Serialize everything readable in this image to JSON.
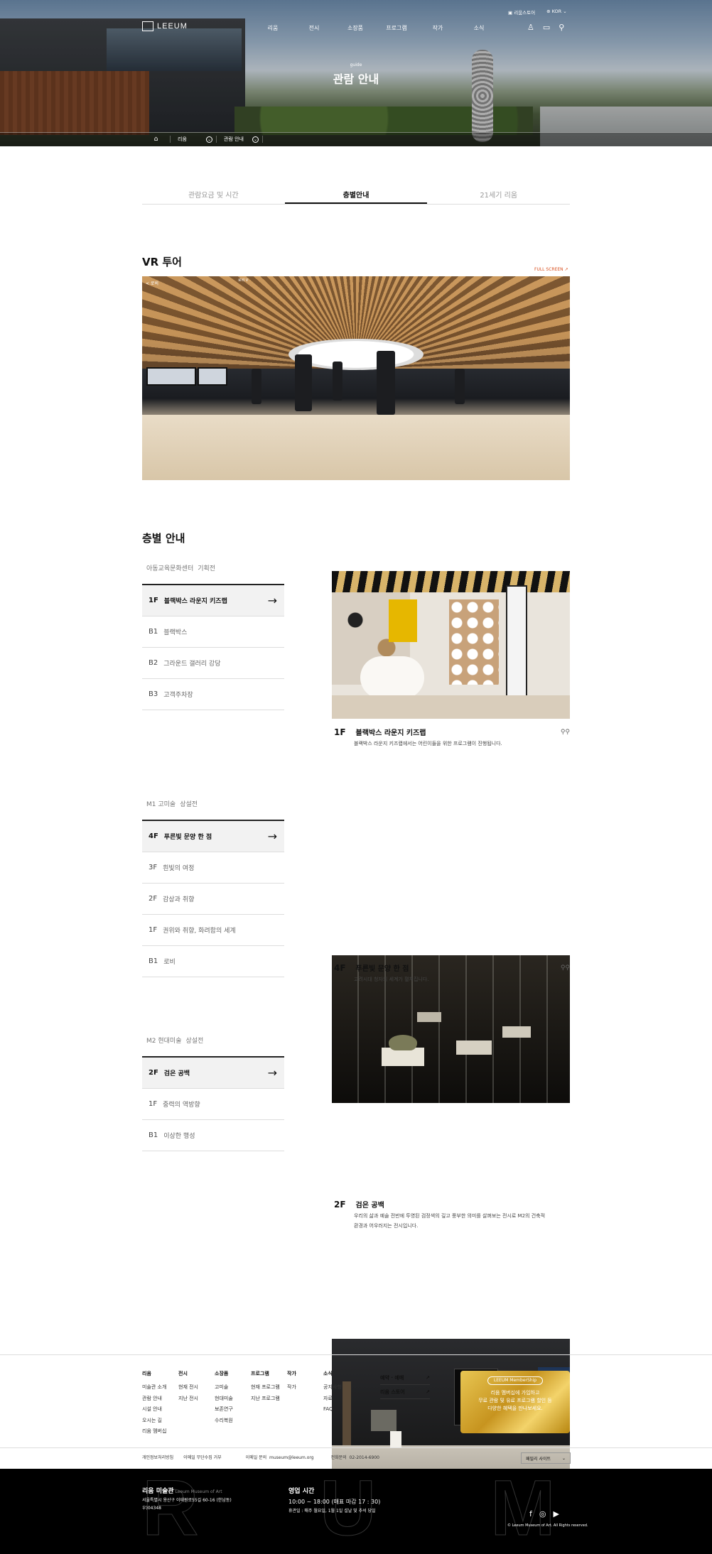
{
  "header": {
    "logo": "LEEUM",
    "nav": [
      "리움",
      "전시",
      "소장품",
      "프로그램",
      "작가",
      "소식"
    ],
    "util_store": "리움스토어",
    "util_lang": "KOR",
    "guide_sub": "guide",
    "title": "관람 안내",
    "breadcrumb": [
      "리움",
      "관람 안내"
    ]
  },
  "tabs": [
    {
      "label": "관람요금 및 시간",
      "active": false
    },
    {
      "label": "층별안내",
      "active": true
    },
    {
      "label": "21세기 리움",
      "active": false
    }
  ],
  "vr": {
    "heading": "VR 투어",
    "full_screen": "FULL SCREEN ↗",
    "top_left": "< 로비",
    "top_title": "로비 V"
  },
  "floors": {
    "heading": "층별 안내",
    "sections": [
      {
        "title": "아동교육문화센터",
        "tag": "기획전",
        "rows": [
          {
            "fl": "1F",
            "name": "블랙박스 라운지 키즈랩",
            "active": true
          },
          {
            "fl": "B1",
            "name": "블랙박스"
          },
          {
            "fl": "B2",
            "name": "그라운드 갤러리 강당"
          },
          {
            "fl": "B3",
            "name": "고객주차장"
          }
        ],
        "caption_fl": "1F",
        "caption": "블랙박스 라운지 키즈랩",
        "desc": [
          "블랙박스 라운지 키즈랩에서는 어린이들을 위한 프로그램이 진행됩니다."
        ]
      },
      {
        "title": "M1 고미술",
        "tag": "상설전",
        "rows": [
          {
            "fl": "4F",
            "name": "푸른빛 문양 한 점",
            "active": true
          },
          {
            "fl": "3F",
            "name": "흰빛의 여정"
          },
          {
            "fl": "2F",
            "name": "감상과 취향"
          },
          {
            "fl": "1F",
            "name": "권위와 취향, 화려함의 세계"
          },
          {
            "fl": "B1",
            "name": "로비"
          }
        ],
        "caption_fl": "4F",
        "caption": "푸른빛 문양 한 점",
        "desc": [
          "고려시대 청자의 세계가 펼쳐집니다."
        ]
      },
      {
        "title": "M2 현대미술",
        "tag": "상설전",
        "rows": [
          {
            "fl": "2F",
            "name": "검은 공백",
            "active": true
          },
          {
            "fl": "1F",
            "name": "중력의 역방향"
          },
          {
            "fl": "B1",
            "name": "이상한 행성"
          }
        ],
        "caption_fl": "2F",
        "caption": "검은 공백",
        "desc": [
          "우리의 삶과 예술 전반에 투영된 검정색의 깊고 풍부한 의미를 살펴보는 전시로 M2의 건축적",
          "환경과 어우러지는 전시입니다."
        ]
      }
    ]
  },
  "footer": {
    "cols": [
      {
        "h": "리움",
        "items": [
          "미술관 소개",
          "관람 안내",
          "시설 안내",
          "오시는 길",
          "리움 멤버십"
        ]
      },
      {
        "h": "전시",
        "items": [
          "현재 전시",
          "지난 전시"
        ]
      },
      {
        "h": "소장품",
        "items": [
          "고미술",
          "현대미술",
          "보존연구",
          "수리복원"
        ]
      },
      {
        "h": "프로그램",
        "items": [
          "현재 프로그램",
          "지난 프로그램"
        ]
      },
      {
        "h": "작가",
        "items": [
          "작가"
        ]
      },
      {
        "h": "소식",
        "items": [
          "공지사항",
          "자료",
          "FAQ"
        ]
      }
    ],
    "quick": [
      "예약 · 예매",
      "리움 스토어"
    ],
    "membership": {
      "pill": "LEEUM MemberShip",
      "l1": "리움 멤버십에 가입하고",
      "l2": "무료 관람 및 유료 프로그램 할인 등",
      "l3": "다양한 혜택을 만나보세요."
    },
    "links": [
      "개인정보처리방침",
      "이메일 무단수집 거부",
      "이메일 문의",
      "museum@leeum.org",
      "전화문의",
      "02-2014-6900"
    ],
    "family": "패밀리 사이트",
    "org": "리움 미술관",
    "org_en": "Leeum Museum of Art",
    "addr": "서울특별시 용산구 이태원로55길 60-16 (한남동)",
    "addr2": "우)04348",
    "hours_t": "영업 시간",
    "hours": "10:00 ~ 18:00 (매표 마감 17 : 30)",
    "hours2": "휴관일 : 매주 월요일, 1월 1일 설날 및 추석 당일",
    "copy": "© Leeum Museum of Art. All Rights reserved."
  }
}
